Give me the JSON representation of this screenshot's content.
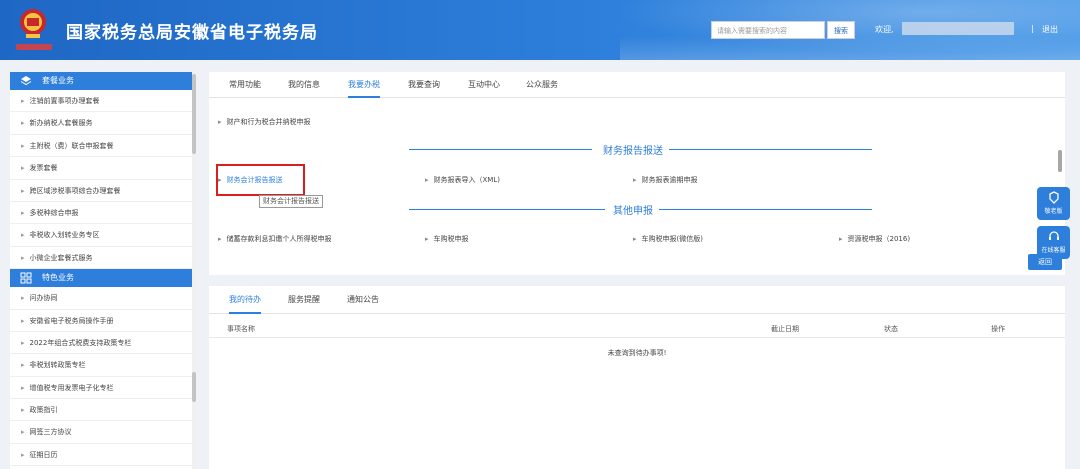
{
  "header": {
    "title": "国家税务总局安徽省电子税务局",
    "emblem_caption": "中國稅務",
    "search_placeholder": "请输入需要搜索的内容",
    "search_button": "搜索",
    "welcome": "欢迎,",
    "separator": "|",
    "logout": "退出"
  },
  "sidebar": {
    "package_header": "套餐业务",
    "package_items": [
      "注销前置事项办理套餐",
      "新办纳税人套餐服务",
      "主附税（费）联合申报套餐",
      "发票套餐",
      "跨区域涉税事项综合办理套餐",
      "多税种综合申报",
      "非税收入划转业务专区",
      "小微企业套餐式服务"
    ],
    "feature_header": "特色业务",
    "feature_items": [
      "问办协同",
      "安徽省电子税务局操作手册",
      "2022年组合式税费支持政策专栏",
      "非税划转政策专栏",
      "增值税专用发票电子化专栏",
      "政策指引",
      "网签三方协议",
      "征期日历"
    ]
  },
  "top_tabs": [
    "常用功能",
    "我的信息",
    "我要办税",
    "我要查询",
    "互动中心",
    "公众服务"
  ],
  "content": {
    "first_link": "财产和行为税合并纳税申报",
    "section1": "财务报告报送",
    "section1_links": [
      "财务会计报告报送",
      "财务报表导入（XML)",
      "财务报表逾期申报"
    ],
    "tooltip": "财务会计报告报送",
    "section2": "其他申报",
    "section2_links": [
      "储蓄存款利息扣缴个人所得税申报",
      "车购税申报",
      "车购税申报(微信版)",
      "资源税申报（2016)"
    ]
  },
  "bottom": {
    "tabs": [
      "我的待办",
      "服务提醒",
      "通知公告"
    ],
    "columns": [
      "事项名称",
      "截止日期",
      "状态",
      "操作"
    ],
    "empty_message": "未查询到待办事项!"
  },
  "floating": {
    "elder": "敬老版",
    "service": "在线客服",
    "back": "返回"
  }
}
